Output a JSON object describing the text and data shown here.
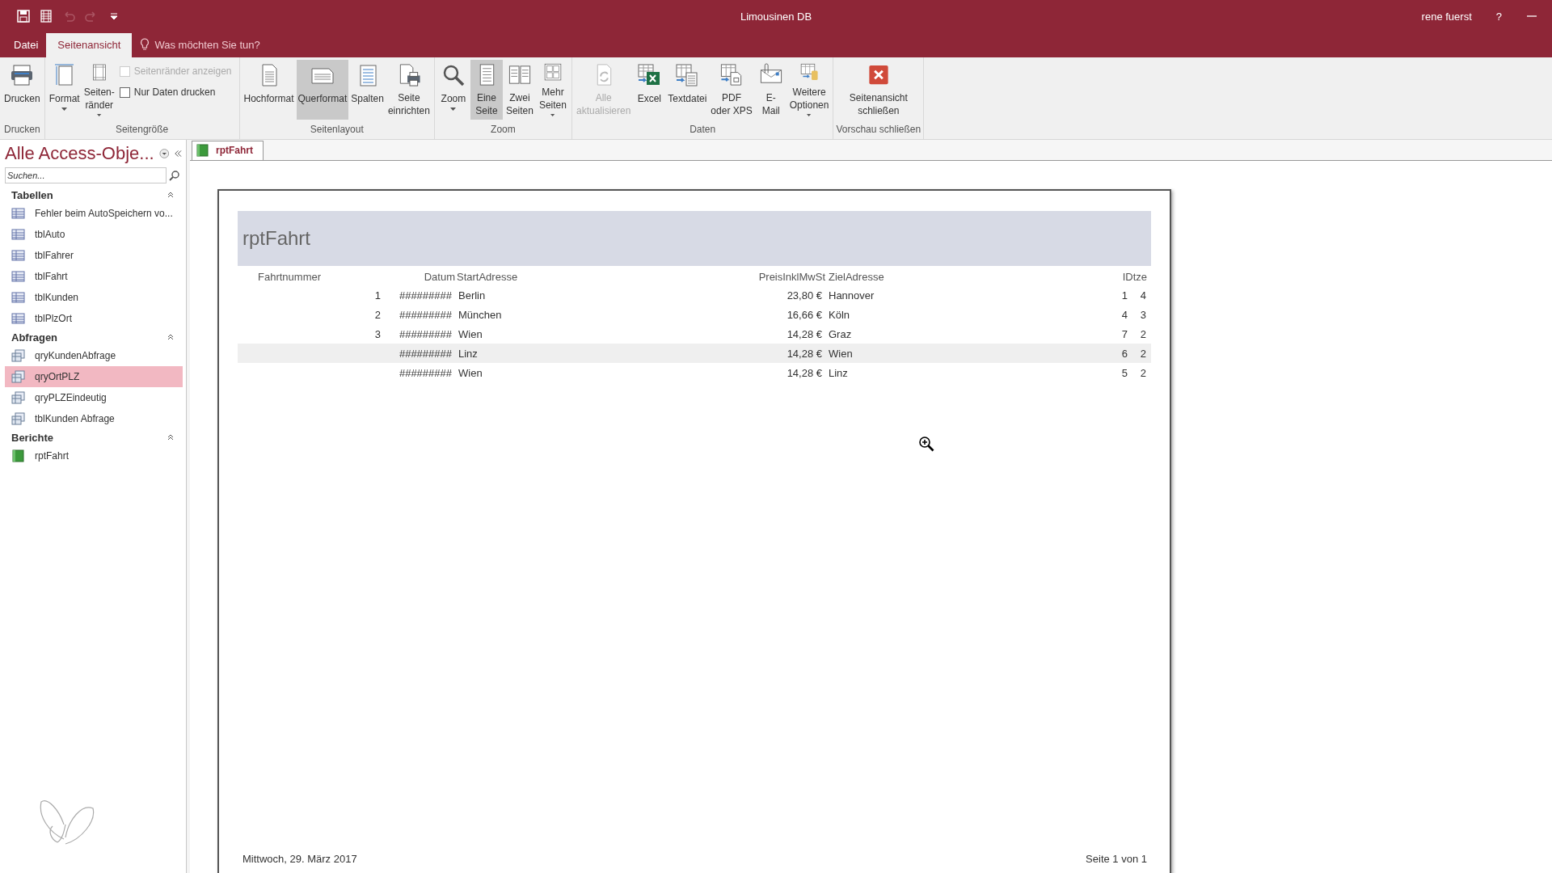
{
  "window": {
    "title": "Limousinen DB",
    "user": "rene fuerst",
    "help": "?"
  },
  "quick_access": [
    {
      "kind": "save",
      "disabled": false
    },
    {
      "kind": "form",
      "disabled": false
    },
    {
      "kind": "undo",
      "disabled": true
    },
    {
      "kind": "redo",
      "disabled": true
    },
    {
      "kind": "customize",
      "disabled": false
    }
  ],
  "tabs": [
    {
      "label": "Datei",
      "selected": false
    },
    {
      "label": "Seitenansicht",
      "selected": true
    }
  ],
  "tell_me": {
    "placeholder": "Was möchten Sie tun?"
  },
  "ribbon": {
    "groups": [
      {
        "label": "Drucken",
        "items": [
          {
            "kind": "large",
            "lines": [
              "Drucken"
            ],
            "dropdown": false,
            "selected": false,
            "disabled": false
          }
        ]
      },
      {
        "label": "Seitengröße",
        "items": [
          {
            "kind": "large",
            "lines": [
              "Format"
            ],
            "dropdown": true,
            "selected": false,
            "disabled": false
          },
          {
            "kind": "large",
            "lines": [
              "Seiten-",
              "ränder"
            ],
            "dropdown": true,
            "selected": false,
            "disabled": false
          },
          {
            "kind": "checks",
            "checks": [
              {
                "label": "Seitenränder anzeigen",
                "checked": false,
                "disabled": true
              },
              {
                "label": "Nur Daten drucken",
                "checked": false,
                "disabled": false
              }
            ]
          }
        ]
      },
      {
        "label": "Seitenlayout",
        "items": [
          {
            "kind": "large",
            "lines": [
              "Hochformat"
            ],
            "dropdown": false,
            "selected": false,
            "disabled": false
          },
          {
            "kind": "large",
            "lines": [
              "Querformat"
            ],
            "dropdown": false,
            "selected": true,
            "disabled": false
          },
          {
            "kind": "large",
            "lines": [
              "Spalten"
            ],
            "dropdown": false,
            "selected": false,
            "disabled": false
          },
          {
            "kind": "large",
            "lines": [
              "Seite",
              "einrichten"
            ],
            "dropdown": false,
            "selected": false,
            "disabled": false
          }
        ]
      },
      {
        "label": "Zoom",
        "items": [
          {
            "kind": "large",
            "lines": [
              "Zoom"
            ],
            "dropdown": true,
            "selected": false,
            "disabled": false
          },
          {
            "kind": "large",
            "lines": [
              "Eine",
              "Seite"
            ],
            "dropdown": false,
            "selected": true,
            "disabled": false
          },
          {
            "kind": "large",
            "lines": [
              "Zwei",
              "Seiten"
            ],
            "dropdown": false,
            "selected": false,
            "disabled": false
          },
          {
            "kind": "large",
            "lines": [
              "Mehr",
              "Seiten"
            ],
            "dropdown": true,
            "selected": false,
            "disabled": false
          }
        ]
      },
      {
        "label": "Daten",
        "items": [
          {
            "kind": "large",
            "lines": [
              "Alle",
              "aktualisieren"
            ],
            "dropdown": false,
            "selected": false,
            "disabled": true
          },
          {
            "kind": "large",
            "lines": [
              "Excel"
            ],
            "dropdown": false,
            "selected": false,
            "disabled": false
          },
          {
            "kind": "large",
            "lines": [
              "Textdatei"
            ],
            "dropdown": false,
            "selected": false,
            "disabled": false
          },
          {
            "kind": "large",
            "lines": [
              "PDF",
              "oder XPS"
            ],
            "dropdown": false,
            "selected": false,
            "disabled": false
          },
          {
            "kind": "large",
            "lines": [
              "E-",
              "Mail"
            ],
            "dropdown": false,
            "selected": false,
            "disabled": false
          },
          {
            "kind": "large",
            "lines": [
              "Weitere",
              "Optionen"
            ],
            "dropdown": true,
            "selected": false,
            "disabled": false
          }
        ]
      },
      {
        "label": "Vorschau schließen",
        "items": [
          {
            "kind": "large",
            "lines": [
              "Seitenansicht",
              "schließen"
            ],
            "dropdown": false,
            "selected": false,
            "disabled": false
          }
        ]
      }
    ]
  },
  "sidebar": {
    "title": "Alle Access-Obje...",
    "search": {
      "placeholder": "Suchen..."
    },
    "groups": [
      {
        "label": "Tabellen",
        "expanded": true,
        "items": [
          {
            "label": "Fehler beim AutoSpeichern vo...",
            "kind": "table",
            "selected": false
          },
          {
            "label": "tblAuto",
            "kind": "table",
            "selected": false
          },
          {
            "label": "tblFahrer",
            "kind": "table",
            "selected": false
          },
          {
            "label": "tblFahrt",
            "kind": "table",
            "selected": false
          },
          {
            "label": "tblKunden",
            "kind": "table",
            "selected": false
          },
          {
            "label": "tblPlzOrt",
            "kind": "table",
            "selected": false
          }
        ]
      },
      {
        "label": "Abfragen",
        "expanded": true,
        "items": [
          {
            "label": "qryKundenAbfrage",
            "kind": "query",
            "selected": false
          },
          {
            "label": "qryOrtPLZ",
            "kind": "query",
            "selected": true
          },
          {
            "label": "qryPLZEindeutig",
            "kind": "query",
            "selected": false
          },
          {
            "label": "tblKunden Abfrage",
            "kind": "query",
            "selected": false
          }
        ]
      },
      {
        "label": "Berichte",
        "expanded": true,
        "items": [
          {
            "label": "rptFahrt",
            "kind": "report",
            "selected": false
          }
        ]
      }
    ]
  },
  "document_tabs": [
    {
      "label": "rptFahrt",
      "selected": true
    }
  ],
  "report": {
    "title": "rptFahrt",
    "columns": [
      "Fahrtnummer",
      "Datum",
      "StartAdresse",
      "PreisInklMwSt",
      "ZielAdresse",
      "IDtze"
    ],
    "rows": [
      {
        "fahrtnummer": "1",
        "datum": "#########",
        "start": "Berlin",
        "preis": "23,80 €",
        "ziel": "Hannover",
        "column_6": "1",
        "column_7": "4",
        "highlighted": false
      },
      {
        "fahrtnummer": "2",
        "datum": "#########",
        "start": "München",
        "preis": "16,66 €",
        "ziel": "Köln",
        "column_6": "4",
        "column_7": "3",
        "highlighted": false
      },
      {
        "fahrtnummer": "3",
        "datum": "#########",
        "start": "Wien",
        "preis": "14,28 €",
        "ziel": "Graz",
        "column_6": "7",
        "column_7": "2",
        "highlighted": false
      },
      {
        "datum": "#########",
        "start": "Linz",
        "preis": "14,28 €",
        "ziel": "Wien",
        "column_6": "6",
        "column_7": "2",
        "highlighted": true
      },
      {
        "datum": "#########",
        "start": "Wien",
        "preis": "14,28 €",
        "ziel": "Linz",
        "column_6": "5",
        "column_7": "2",
        "highlighted": false
      }
    ],
    "footer_date": "Mittwoch, 29. März 2017",
    "footer_page": "Seite 1 von 1"
  }
}
